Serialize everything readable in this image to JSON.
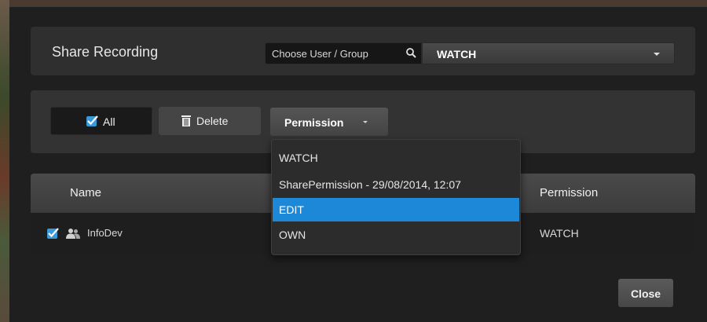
{
  "header": {
    "title": "Share Recording",
    "user_field_label": "Choose User / Group",
    "permission_value": "WATCH"
  },
  "toolbar": {
    "all_label": "All",
    "delete_label": "Delete",
    "permission_label": "Permission"
  },
  "table": {
    "columns": {
      "name": "Name",
      "permission": "Permission"
    },
    "rows": [
      {
        "name": "InfoDev",
        "permission": "WATCH"
      }
    ]
  },
  "dropdown": {
    "items": [
      "WATCH",
      "SharePermission - 29/08/2014, 12:07",
      "EDIT",
      "OWN"
    ],
    "selected": "EDIT"
  },
  "footer": {
    "close_label": "Close"
  },
  "colors": {
    "accent": "#1e88d8",
    "checkbox": "#3a9ad9"
  }
}
